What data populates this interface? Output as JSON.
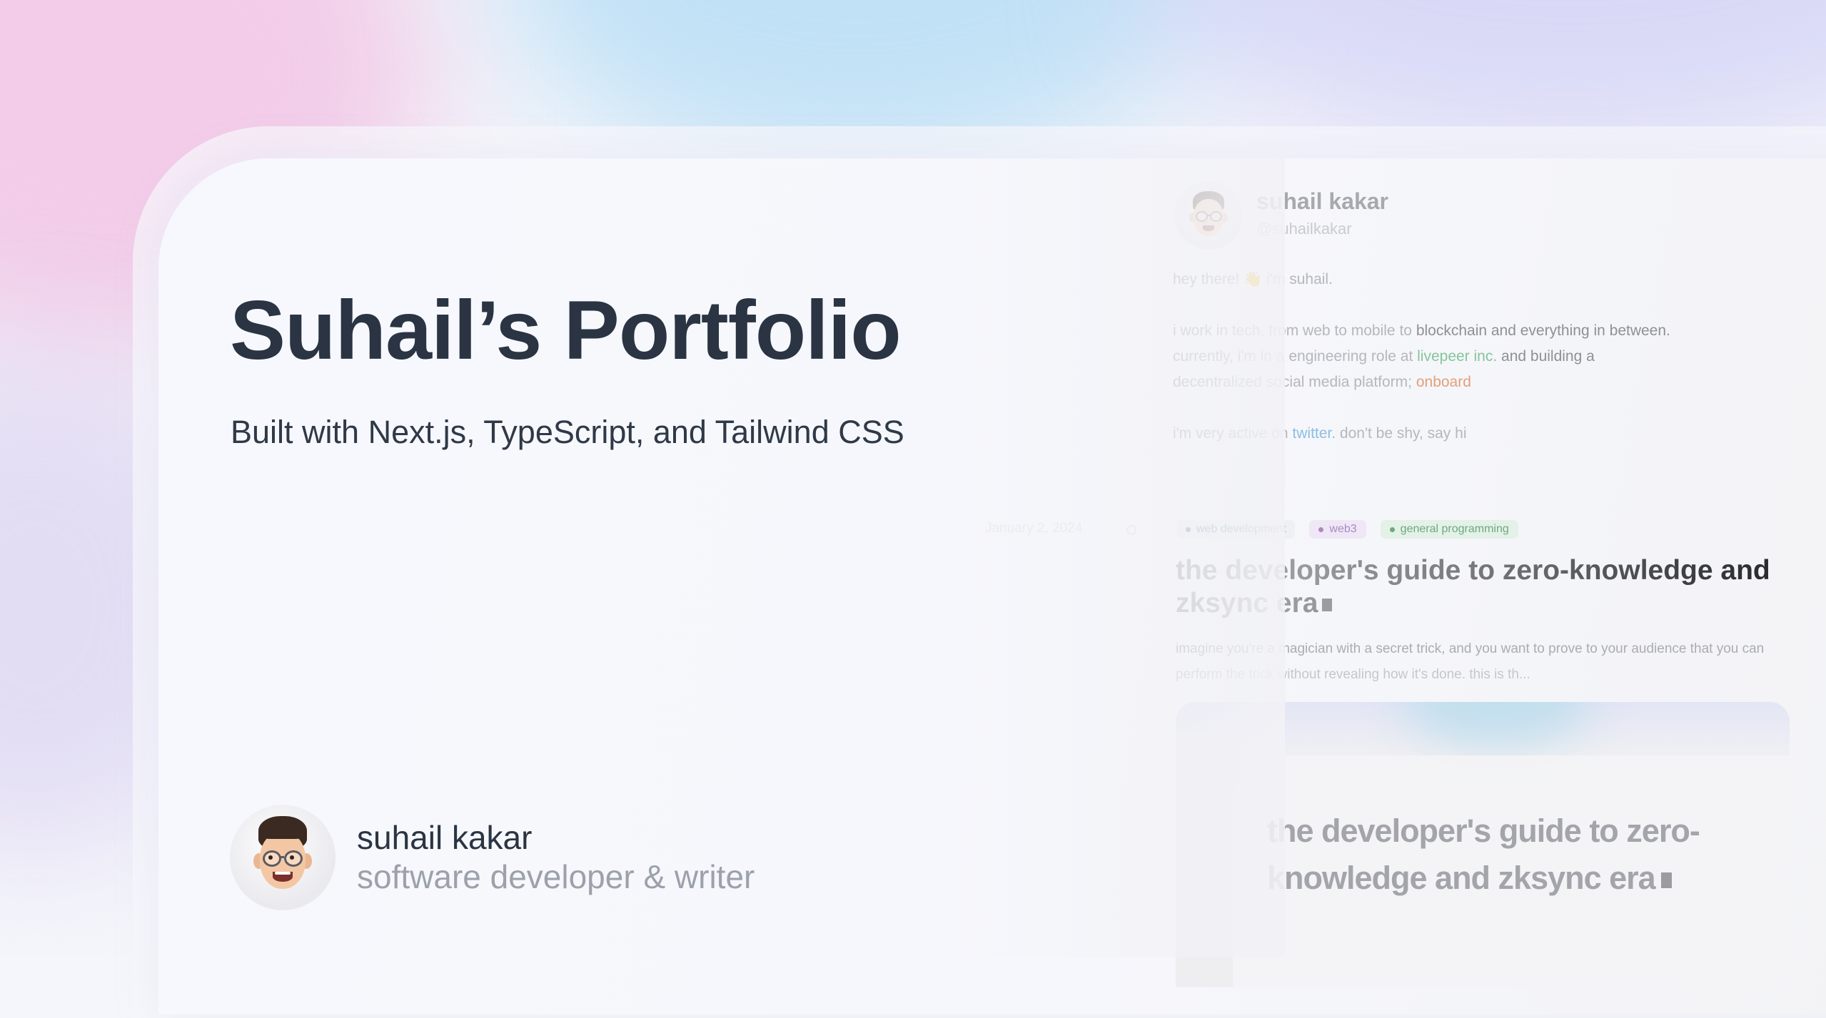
{
  "hero": {
    "title": "Suhail’s Portfolio",
    "subtitle": "Built with Next.js, TypeScript, and Tailwind CSS"
  },
  "author": {
    "name": "suhail kakar",
    "role": "software developer & writer",
    "avatar_icon": "memoji-avatar-icon"
  },
  "preview": {
    "profile": {
      "name": "suhail kakar",
      "handle": "@suhailkakar"
    },
    "bio": {
      "greeting": "hey there! 👋 i'm suhail.",
      "line1_a": "i work in tech, from web to mobile to ",
      "line1_b": "blockchain and everything in between.",
      "line2_a": "currently, i'm in a engineering role at ",
      "line2_link": "livepeer inc.",
      "line2_b": " and building a",
      "line3_a": "decentralized social media platform; ",
      "line3_link": "onboard",
      "line4_a": "i'm very active on ",
      "line4_link": "twitter.",
      "line4_b": " don't be shy, say hi"
    },
    "post": {
      "date": "January 2, 2024",
      "tags": [
        "web development",
        "web3",
        "general programming"
      ],
      "title": "the developer's guide to zero-knowledge and zksync era",
      "excerpt_a": "imagine you're a magician with a secret trick, and you want to prove to your audience that you can",
      "excerpt_b": "perform the trick without revealing how it's done. this is th...",
      "thumbnail_title": "the developer's guide to zero-knowledge and zksync era"
    }
  },
  "colors": {
    "title_text": "#2a3443",
    "muted_text": "#9ca1ab",
    "link_green": "#86c59a",
    "link_orange": "#e2a07a",
    "link_blue": "#8bbfe2"
  }
}
